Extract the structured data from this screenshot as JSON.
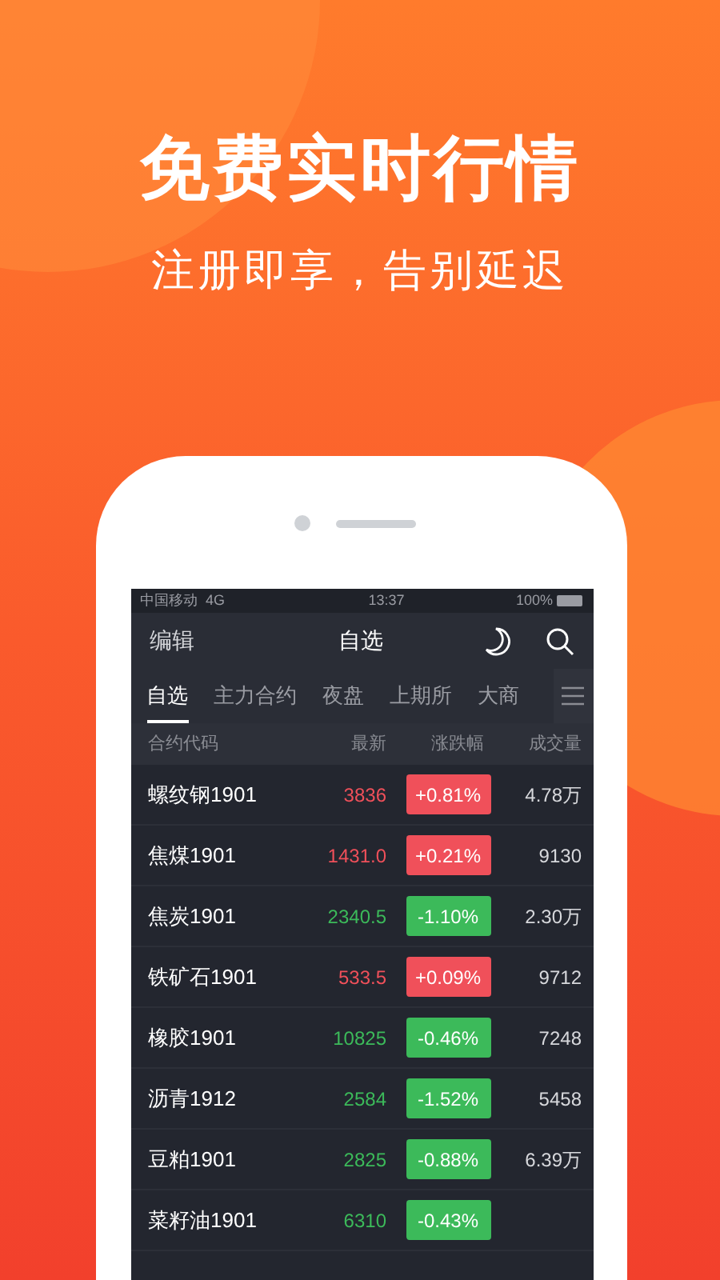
{
  "headline": "免费实时行情",
  "subheadline": "注册即享，告别延迟",
  "status_bar": {
    "carrier": "中国移动",
    "network": "4G",
    "time": "13:37",
    "battery": "100%"
  },
  "nav": {
    "left": "编辑",
    "title": "自选"
  },
  "tabs": [
    {
      "label": "自选",
      "selected": true
    },
    {
      "label": "主力合约",
      "selected": false
    },
    {
      "label": "夜盘",
      "selected": false
    },
    {
      "label": "上期所",
      "selected": false
    },
    {
      "label": "大商",
      "selected": false
    }
  ],
  "table": {
    "columns": [
      "合约代码",
      "最新",
      "涨跌幅",
      "成交量"
    ],
    "rows": [
      {
        "name": "螺纹钢1901",
        "price": "3836",
        "change": "+0.81%",
        "volume": "4.78万",
        "color": "#f0505a"
      },
      {
        "name": "焦煤1901",
        "price": "1431.0",
        "change": "+0.21%",
        "volume": "9130",
        "color": "#f0505a"
      },
      {
        "name": "焦炭1901",
        "price": "2340.5",
        "change": "-1.10%",
        "volume": "2.30万",
        "color": "#3cba5a"
      },
      {
        "name": "铁矿石1901",
        "price": "533.5",
        "change": "+0.09%",
        "volume": "9712",
        "color": "#f0505a"
      },
      {
        "name": "橡胶1901",
        "price": "10825",
        "change": "-0.46%",
        "volume": "7248",
        "color": "#3cba5a"
      },
      {
        "name": "沥青1912",
        "price": "2584",
        "change": "-1.52%",
        "volume": "5458",
        "color": "#3cba5a"
      },
      {
        "name": "豆粕1901",
        "price": "2825",
        "change": "-0.88%",
        "volume": "6.39万",
        "color": "#3cba5a"
      },
      {
        "name": "菜籽油1901",
        "price": "6310",
        "change": "-0.43%",
        "color": "#3cba5a"
      }
    ]
  }
}
